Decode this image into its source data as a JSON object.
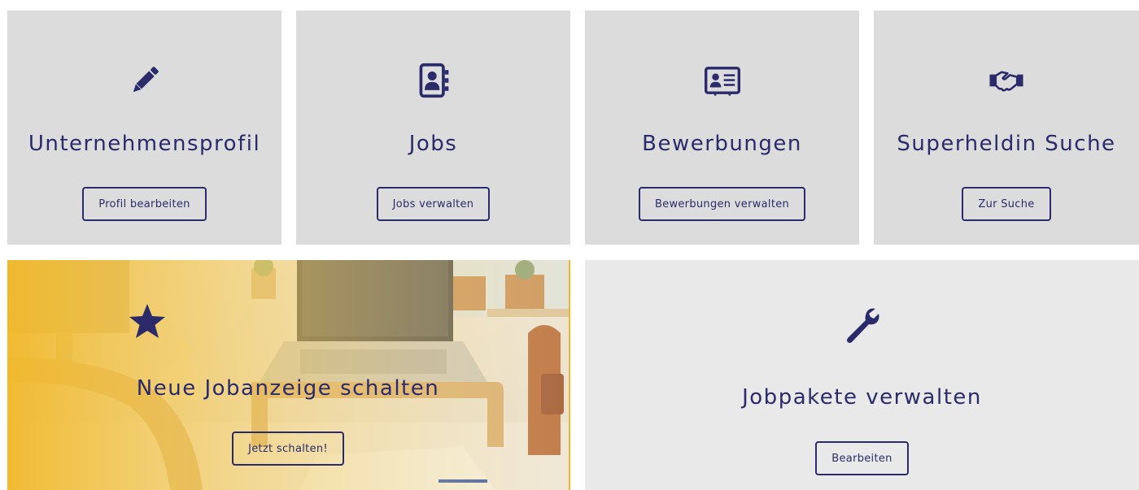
{
  "colors": {
    "accent": "#2b2a6b",
    "tile_background": "#dcdcdc",
    "tile_background_light": "#e9e9e9",
    "highlight_yellow": "#f5c54a"
  },
  "tiles": [
    {
      "title": "Unternehmensprofil",
      "button": "Profil bearbeiten",
      "icon": "pencil-icon"
    },
    {
      "title": "Jobs",
      "button": "Jobs verwalten",
      "icon": "contact-book-icon"
    },
    {
      "title": "Bewerbungen",
      "button": "Bewerbungen verwalten",
      "icon": "id-card-icon"
    },
    {
      "title": "Superheldin Suche",
      "button": "Zur Suche",
      "icon": "handshake-icon"
    }
  ],
  "new_job": {
    "title": "Neue Jobanzeige schalten",
    "button": "Jetzt schalten!",
    "icon": "star-icon"
  },
  "packages": {
    "title": "Jobpakete verwalten",
    "button": "Bearbeiten",
    "icon": "wrench-icon"
  }
}
